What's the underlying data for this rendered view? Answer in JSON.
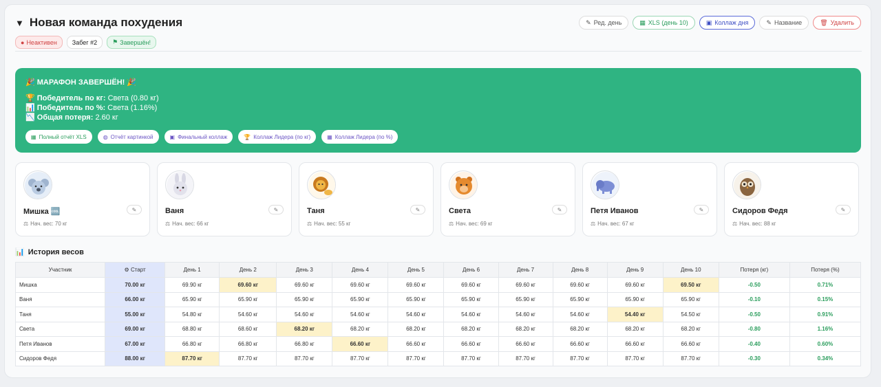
{
  "header": {
    "title": "Новая команда похудения",
    "badges": {
      "inactive": "Неактивен",
      "race": "Забег #2",
      "done": "Завершён!"
    },
    "actions": {
      "edit_day": "Ред. день",
      "xls": "XLS (день 10)",
      "collage": "Коллаж дня",
      "rename": "Название",
      "delete": "Удалить"
    }
  },
  "banner": {
    "title": "МАРАФОН ЗАВЕРШЁН!",
    "winner_kg_label": "Победитель по кг:",
    "winner_kg_value": "Света (0.80 кг)",
    "winner_pct_label": "Победитель по %:",
    "winner_pct_value": "Света (1.16%)",
    "total_label": "Общая потеря:",
    "total_value": "2.60 кг",
    "buttons": [
      "Полный отчёт XLS",
      "Отчёт картинкой",
      "Финальный коллаж",
      "Коллаж Лидера (по кг)",
      "Коллаж Лидера (по %)"
    ]
  },
  "members": [
    {
      "name": "Мишка 🆒",
      "weight": "Нач. вес: 70 кг",
      "avatar": "koala"
    },
    {
      "name": "Ваня",
      "weight": "Нач. вес: 66 кг",
      "avatar": "bunny"
    },
    {
      "name": "Таня",
      "weight": "Нач. вес: 55 кг",
      "avatar": "lion"
    },
    {
      "name": "Света",
      "weight": "Нач. вес: 69 кг",
      "avatar": "hamster"
    },
    {
      "name": "Петя Иванов",
      "weight": "Нач. вес: 67 кг",
      "avatar": "elephant"
    },
    {
      "name": "Сидоров Федя",
      "weight": "Нач. вес: 88 кг",
      "avatar": "owl"
    }
  ],
  "history": {
    "title": "История весов",
    "columns": [
      "Участник",
      "Старт",
      "День 1",
      "День 2",
      "День 3",
      "День 4",
      "День 5",
      "День 6",
      "День 7",
      "День 8",
      "День 9",
      "День 10",
      "Потеря (кг)",
      "Потеря (%)"
    ],
    "rows": [
      {
        "cells": [
          "Мишка",
          "70.00 кг",
          "69.90 кг",
          "69.60 кг",
          "69.60 кг",
          "69.60 кг",
          "69.60 кг",
          "69.60 кг",
          "69.60 кг",
          "69.60 кг",
          "69.60 кг",
          "69.50 кг",
          "-0.50",
          "0.71%"
        ],
        "hl": [
          3,
          11
        ]
      },
      {
        "cells": [
          "Ваня",
          "66.00 кг",
          "65.90 кг",
          "65.90 кг",
          "65.90 кг",
          "65.90 кг",
          "65.90 кг",
          "65.90 кг",
          "65.90 кг",
          "65.90 кг",
          "65.90 кг",
          "65.90 кг",
          "-0.10",
          "0.15%"
        ],
        "hl": []
      },
      {
        "cells": [
          "Таня",
          "55.00 кг",
          "54.80 кг",
          "54.60 кг",
          "54.60 кг",
          "54.60 кг",
          "54.60 кг",
          "54.60 кг",
          "54.60 кг",
          "54.60 кг",
          "54.40 кг",
          "54.50 кг",
          "-0.50",
          "0.91%"
        ],
        "hl": [
          10
        ]
      },
      {
        "cells": [
          "Света",
          "69.00 кг",
          "68.80 кг",
          "68.60 кг",
          "68.20 кг",
          "68.20 кг",
          "68.20 кг",
          "68.20 кг",
          "68.20 кг",
          "68.20 кг",
          "68.20 кг",
          "68.20 кг",
          "-0.80",
          "1.16%"
        ],
        "hl": [
          4
        ]
      },
      {
        "cells": [
          "Петя Иванов",
          "67.00 кг",
          "66.80 кг",
          "66.80 кг",
          "66.80 кг",
          "66.60 кг",
          "66.60 кг",
          "66.60 кг",
          "66.60 кг",
          "66.60 кг",
          "66.60 кг",
          "66.60 кг",
          "-0.40",
          "0.60%"
        ],
        "hl": [
          5
        ]
      },
      {
        "cells": [
          "Сидоров Федя",
          "88.00 кг",
          "87.70 кг",
          "87.70 кг",
          "87.70 кг",
          "87.70 кг",
          "87.70 кг",
          "87.70 кг",
          "87.70 кг",
          "87.70 кг",
          "87.70 кг",
          "87.70 кг",
          "-0.30",
          "0.34%"
        ],
        "hl": [
          2
        ]
      }
    ]
  },
  "colors": {
    "banner": "#2fb482",
    "start_col": "#dfe6fb",
    "highlight": "#fdf2c9",
    "loss": "#2a9d5c"
  }
}
